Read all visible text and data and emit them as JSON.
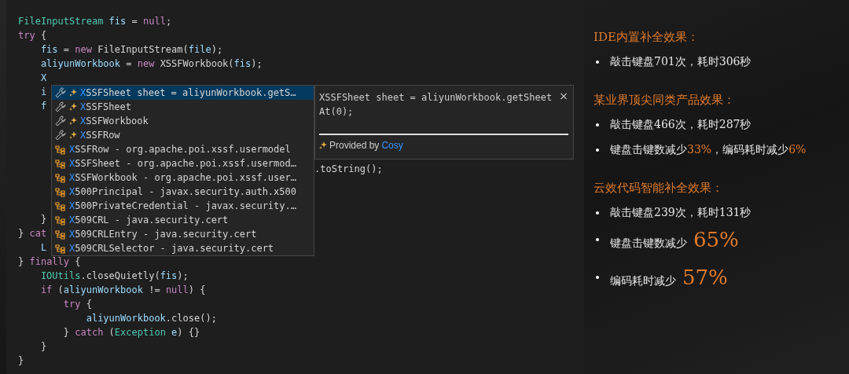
{
  "editor": {
    "lines_top": [
      [
        {
          "text": "FileInputStream",
          "kind": "type"
        },
        {
          "text": " fis",
          "kind": "var"
        },
        {
          "text": " = ",
          "kind": "plain"
        },
        {
          "text": "null",
          "kind": "kw"
        },
        {
          "text": ";",
          "kind": "plain"
        }
      ],
      [
        {
          "text": "try",
          "kind": "kw"
        },
        {
          "text": " {",
          "kind": "plain"
        }
      ],
      [
        {
          "text": "    fis",
          "kind": "var"
        },
        {
          "text": " = ",
          "kind": "plain"
        },
        {
          "text": "new",
          "kind": "kw"
        },
        {
          "text": " FileInputStream(",
          "kind": "plain"
        },
        {
          "text": "file",
          "kind": "var"
        },
        {
          "text": ");",
          "kind": "plain"
        }
      ],
      [
        {
          "text": "    aliyunWorkbook",
          "kind": "var"
        },
        {
          "text": " = ",
          "kind": "plain"
        },
        {
          "text": "new",
          "kind": "kw"
        },
        {
          "text": " XSSFWorkbook(",
          "kind": "plain"
        },
        {
          "text": "fis",
          "kind": "var"
        },
        {
          "text": ");",
          "kind": "plain"
        }
      ],
      [
        {
          "text": "    X",
          "kind": "var"
        }
      ],
      [
        {
          "text": "    i",
          "kind": "var"
        }
      ],
      [
        {
          "text": "    f",
          "kind": "var"
        }
      ]
    ],
    "line_beside_popup": [
      {
        "text": ".toString();",
        "kind": "plain"
      }
    ],
    "lines_bottom": [
      [
        {
          "text": "    }",
          "kind": "plain"
        }
      ],
      [
        {
          "text": "} ",
          "kind": "plain"
        },
        {
          "text": "cat",
          "kind": "kw"
        }
      ],
      [
        {
          "text": "    L",
          "kind": "var"
        }
      ],
      [
        {
          "text": "} ",
          "kind": "plain"
        },
        {
          "text": "finally",
          "kind": "kw"
        },
        {
          "text": " {",
          "kind": "plain"
        }
      ],
      [
        {
          "text": "    IOUtils",
          "kind": "type"
        },
        {
          "text": ".closeQuietly(",
          "kind": "plain"
        },
        {
          "text": "fis",
          "kind": "var"
        },
        {
          "text": ");",
          "kind": "plain"
        }
      ],
      [
        {
          "text": "    if",
          "kind": "kw"
        },
        {
          "text": " (",
          "kind": "plain"
        },
        {
          "text": "aliyunWorkbook",
          "kind": "var"
        },
        {
          "text": " != ",
          "kind": "plain"
        },
        {
          "text": "null",
          "kind": "kw"
        },
        {
          "text": ") {",
          "kind": "plain"
        }
      ],
      [
        {
          "text": "        try",
          "kind": "kw"
        },
        {
          "text": " {",
          "kind": "plain"
        }
      ],
      [
        {
          "text": "            aliyunWorkbook",
          "kind": "var"
        },
        {
          "text": ".close();",
          "kind": "plain"
        }
      ],
      [
        {
          "text": "        } ",
          "kind": "plain"
        },
        {
          "text": "catch",
          "kind": "kw"
        },
        {
          "text": " (",
          "kind": "plain"
        },
        {
          "text": "Exception",
          "kind": "type"
        },
        {
          "text": " e",
          "kind": "var"
        },
        {
          "text": ") {}",
          "kind": "plain"
        }
      ],
      [
        {
          "text": "    }",
          "kind": "plain"
        }
      ],
      [
        {
          "text": "}",
          "kind": "plain"
        }
      ]
    ]
  },
  "suggestions": [
    {
      "kind": "ai",
      "match": "X",
      "rest": "SSFSheet sheet = aliyunWorkbook.getS…",
      "selected": true
    },
    {
      "kind": "ai",
      "match": "X",
      "rest": "SSFSheet",
      "selected": false
    },
    {
      "kind": "ai",
      "match": "X",
      "rest": "SSFWorkbook",
      "selected": false
    },
    {
      "kind": "ai",
      "match": "X",
      "rest": "SSFRow",
      "selected": false
    },
    {
      "kind": "class",
      "match": "X",
      "rest": "SSFRow - org.apache.poi.xssf.usermodel",
      "selected": false
    },
    {
      "kind": "class",
      "match": "X",
      "rest": "SSFSheet - org.apache.poi.xssf.usermod…",
      "selected": false
    },
    {
      "kind": "class",
      "match": "X",
      "rest": "SSFWorkbook - org.apache.poi.xssf.user…",
      "selected": false
    },
    {
      "kind": "class",
      "match": "X",
      "rest": "500Principal - javax.security.auth.x500",
      "selected": false
    },
    {
      "kind": "class",
      "match": "X",
      "rest": "500PrivateCredential - javax.security.…",
      "selected": false
    },
    {
      "kind": "class",
      "match": "X",
      "rest": "509CRL - java.security.cert",
      "selected": false
    },
    {
      "kind": "class",
      "match": "X",
      "rest": "509CRLEntry - java.security.cert",
      "selected": false
    },
    {
      "kind": "class",
      "match": "X",
      "rest": "509CRLSelector - java.security.cert",
      "selected": false
    }
  ],
  "details": {
    "code": "XSSFSheet sheet = aliyunWorkbook.getSheetAt(0);",
    "close": "×",
    "provider": "Provided by",
    "provider_link": "Cosy"
  },
  "sections": [
    {
      "heading": "IDE内置补全效果：",
      "bullets": [
        [
          {
            "text": "敲击键盘701次，耗时306秒",
            "kind": "plain"
          }
        ]
      ]
    },
    {
      "heading": "某业界顶尖同类产品效果：",
      "bullets": [
        [
          {
            "text": "敲击键盘466次，耗时287秒",
            "kind": "plain"
          }
        ],
        [
          {
            "text": "键盘击键数减少",
            "kind": "plain"
          },
          {
            "text": "33%",
            "kind": "accent"
          },
          {
            "text": "，编码耗时减少",
            "kind": "plain"
          },
          {
            "text": "6%",
            "kind": "accent"
          }
        ]
      ]
    },
    {
      "heading": "云效代码智能补全效果：",
      "bullets": [
        [
          {
            "text": "敲击键盘239次，耗时131秒",
            "kind": "plain"
          }
        ],
        [
          {
            "text": "键盘击键数减少",
            "kind": "plain"
          },
          {
            "text": "65%",
            "kind": "big"
          }
        ],
        [
          {
            "text": "编码耗时减少",
            "kind": "plain"
          },
          {
            "text": "57%",
            "kind": "big"
          }
        ]
      ]
    }
  ]
}
